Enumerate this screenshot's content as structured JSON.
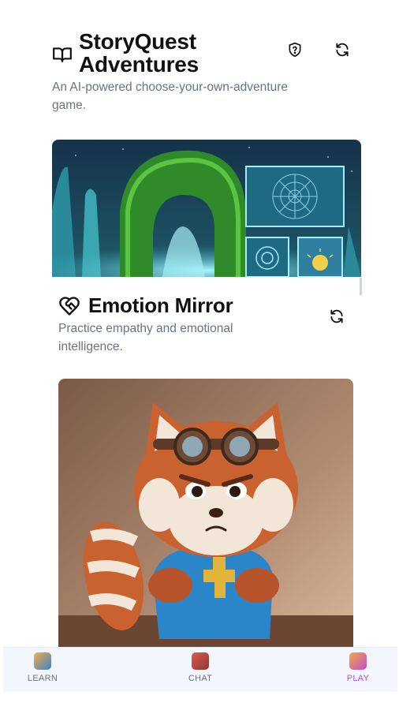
{
  "header": {
    "title": "StoryQuest Adventures",
    "subtitle": "An AI-powered choose-your-own-adventure game.",
    "book_icon": "book-open-icon",
    "help_icon": "shield-question-icon",
    "refresh_icon": "refresh-icon"
  },
  "card2": {
    "title": "Emotion Mirror",
    "subtitle": "Practice empathy and emotional intelligence.",
    "icon": "heart-handshake-icon",
    "refresh_icon": "refresh-icon"
  },
  "nav": {
    "items": [
      {
        "label": "LEARN",
        "icon": "learn-tile-icon"
      },
      {
        "label": "CHAT",
        "icon": "chat-tile-icon"
      },
      {
        "label": "PLAY",
        "icon": "play-tile-icon",
        "active": true
      }
    ]
  },
  "colors": {
    "active_nav": "#a855f7",
    "muted_text": "#6b7280",
    "nav_bg": "#f3f7fd"
  }
}
